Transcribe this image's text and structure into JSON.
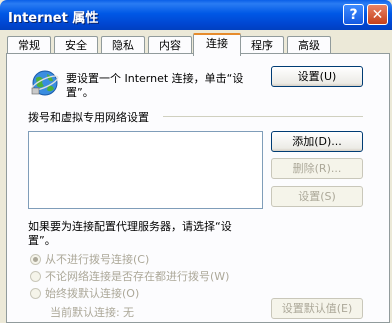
{
  "window": {
    "title": "Internet 属性",
    "help_glyph": "?",
    "close_glyph": "✕"
  },
  "tabs": [
    {
      "label": "常规"
    },
    {
      "label": "安全"
    },
    {
      "label": "隐私"
    },
    {
      "label": "内容"
    },
    {
      "label": "连接",
      "active": true
    },
    {
      "label": "程序"
    },
    {
      "label": "高级"
    }
  ],
  "setup": {
    "line1": "要设置一个 Internet 连接，单击“设",
    "line2": "置”。",
    "button": "设置(U)"
  },
  "dialup": {
    "group_label": "拨号和虚拟专用网络设置",
    "add_button": "添加(D)...",
    "remove_button": "删除(R)...",
    "settings_button": "设置(S)"
  },
  "proxy": {
    "line1": "如果要为连接配置代理服务器，请选择“设",
    "line2": "置”。"
  },
  "options": [
    {
      "label": "从不进行拨号连接(C)",
      "selected": true
    },
    {
      "label": "不论网络连接是否存在都进行拨号(W)",
      "selected": false
    },
    {
      "label": "始终拨默认连接(O)",
      "selected": false
    }
  ],
  "default_conn": {
    "label": "当前默认连接:",
    "value": "无",
    "button": "设置默认值(E)"
  },
  "colors": {
    "title_blue": "#0058e6",
    "tab_accent": "#e68b2c",
    "face": "#ece9d8"
  },
  "icons": {
    "connection": "globe-network-icon"
  }
}
